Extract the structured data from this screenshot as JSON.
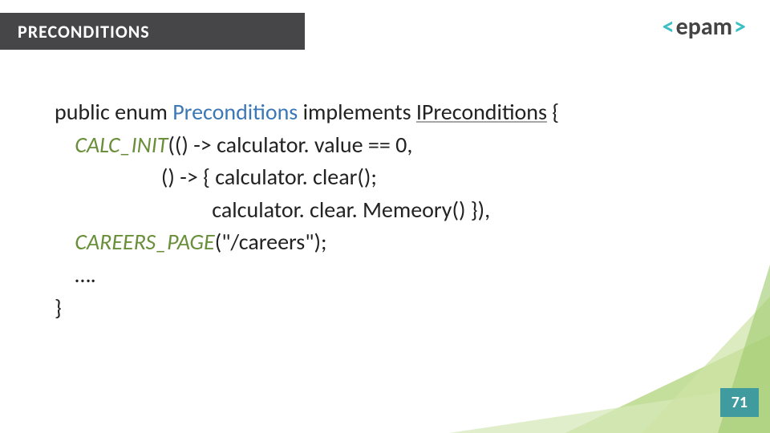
{
  "header": {
    "title": "PRECONDITIONS"
  },
  "logo": {
    "lt": "<",
    "name": "epam",
    "gt": ">"
  },
  "code": {
    "l1": {
      "a": "public enum ",
      "b": "Preconditions ",
      "c": "implements ",
      "d": "IPreconditions",
      "e": " {"
    },
    "l2": {
      "a": "    ",
      "b": "CALC_INIT",
      "c": "(() -> calculator. value == 0,"
    },
    "l3": "                     () -> { calculator. clear();",
    "l4": "                               calculator. clear. Memeory() }),",
    "l5": {
      "a": "    ",
      "b": "CAREERS_PAGE",
      "c": "(\"/careers\");"
    },
    "l6": "    …. ",
    "l7": "}"
  },
  "page_number": "71"
}
